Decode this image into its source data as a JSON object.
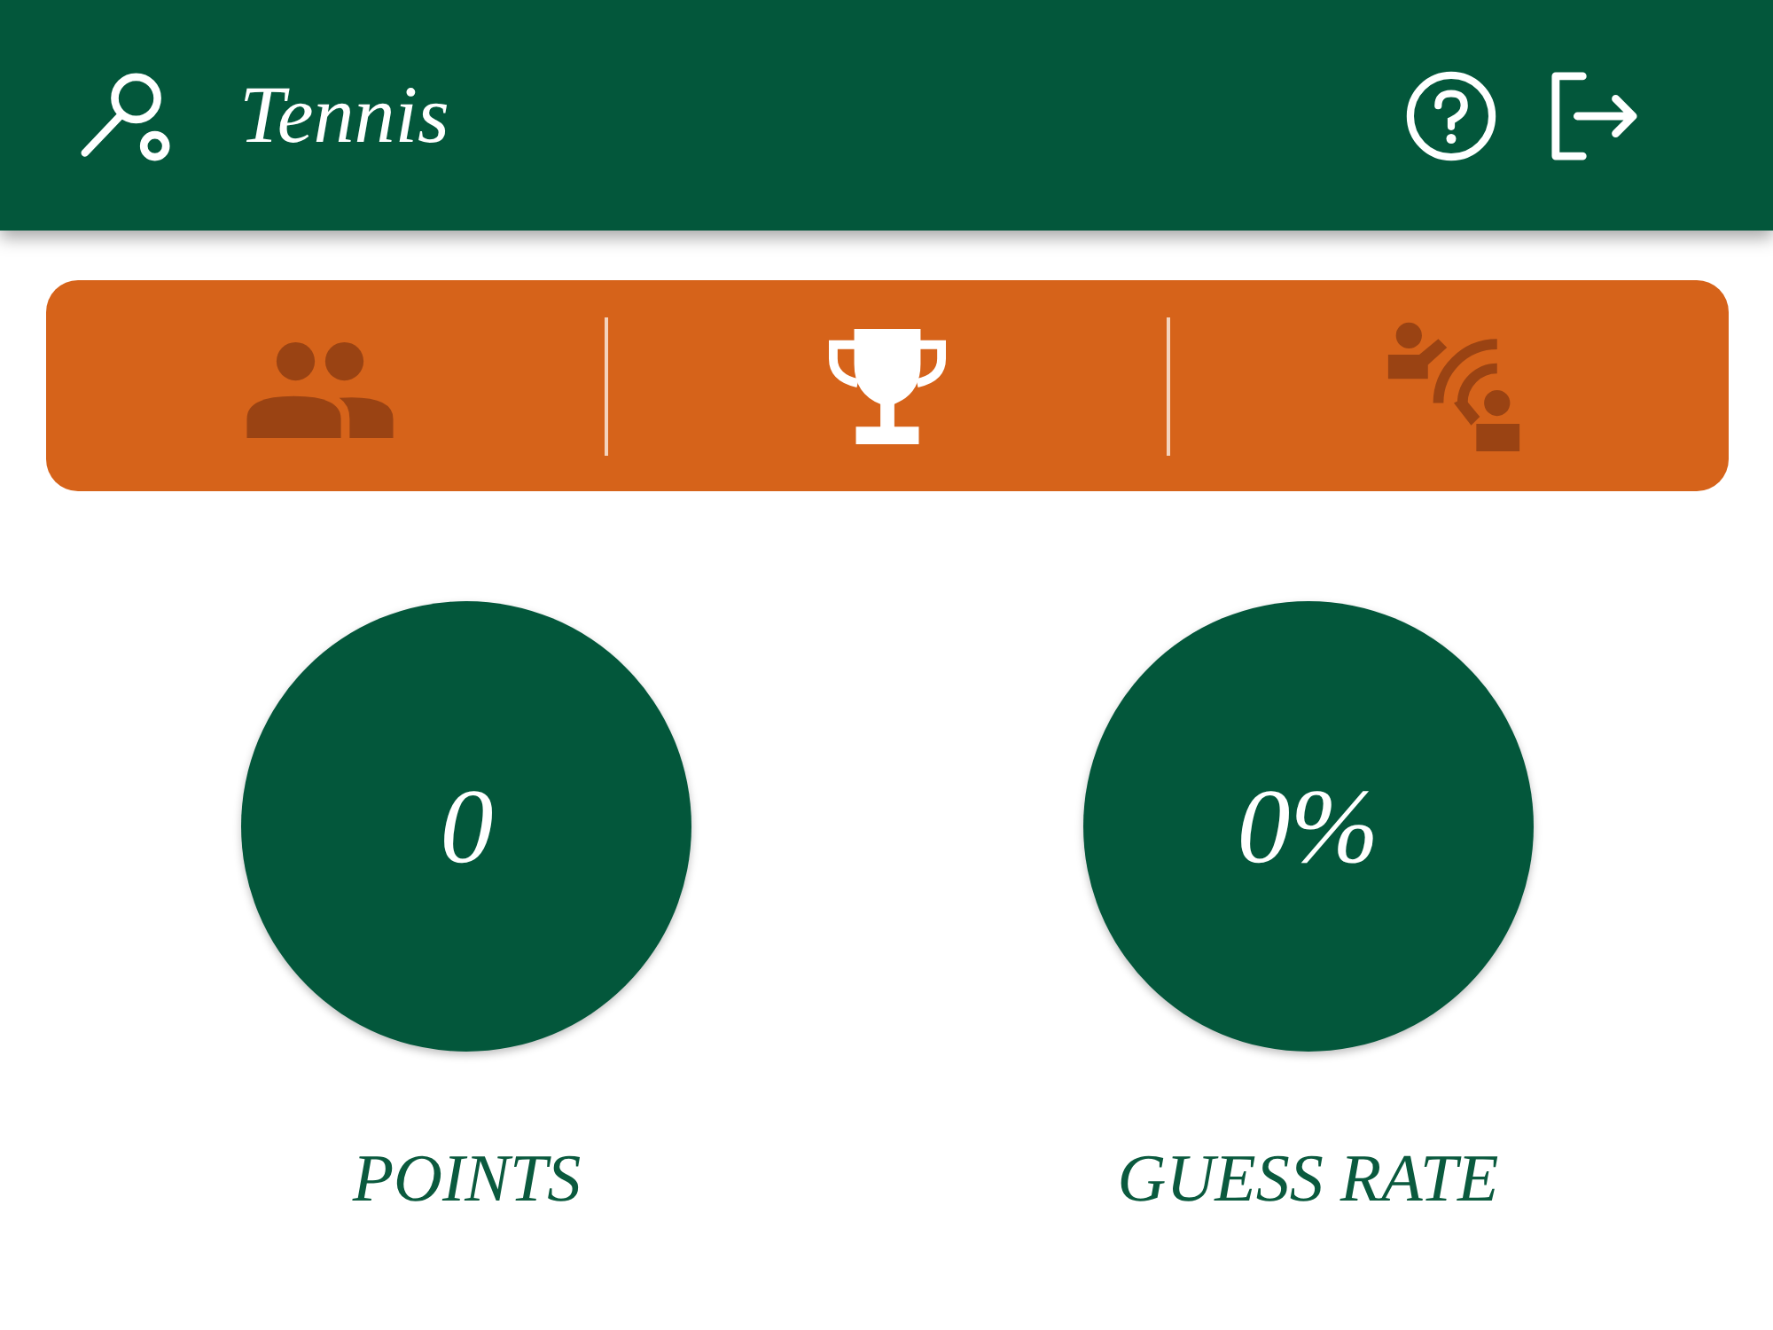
{
  "app_bar": {
    "title": "Tennis"
  },
  "tabs": [
    {
      "kind": "players",
      "selected": false
    },
    {
      "kind": "trophy",
      "selected": true
    },
    {
      "kind": "live",
      "selected": false
    }
  ],
  "stats": [
    {
      "value": "0",
      "label": "POINTS"
    },
    {
      "value": "0%",
      "label": "GUESS RATE"
    }
  ]
}
